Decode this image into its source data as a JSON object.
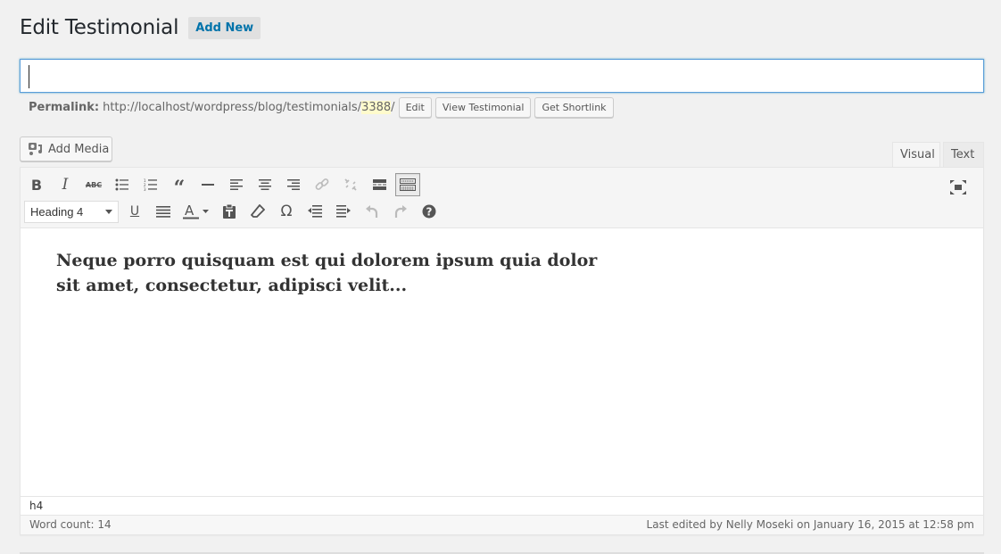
{
  "header": {
    "title": "Edit Testimonial",
    "add_new_label": "Add New"
  },
  "title_input": {
    "value": "",
    "placeholder": ""
  },
  "permalink": {
    "label": "Permalink:",
    "url_prefix": "http://localhost/wordpress/blog/testimonials/",
    "slug": "3388",
    "url_suffix": "/",
    "buttons": [
      "Edit",
      "View Testimonial",
      "Get Shortlink"
    ]
  },
  "media": {
    "add_media_label": "Add Media"
  },
  "editor_tabs": {
    "visual": "Visual",
    "text": "Text",
    "active": "Visual"
  },
  "toolbar": {
    "row1": [
      {
        "name": "bold",
        "icon": "bold-icon"
      },
      {
        "name": "italic",
        "icon": "italic-icon"
      },
      {
        "name": "strikethrough",
        "icon": "strikethrough-icon"
      },
      {
        "name": "bulleted-list",
        "icon": "bulleted-list-icon"
      },
      {
        "name": "numbered-list",
        "icon": "numbered-list-icon"
      },
      {
        "name": "blockquote",
        "icon": "blockquote-icon"
      },
      {
        "name": "horizontal-line",
        "icon": "horizontal-line-icon"
      },
      {
        "name": "align-left",
        "icon": "align-left-icon"
      },
      {
        "name": "align-center",
        "icon": "align-center-icon"
      },
      {
        "name": "align-right",
        "icon": "align-right-icon"
      },
      {
        "name": "insert-link",
        "icon": "link-icon",
        "disabled": true
      },
      {
        "name": "remove-link",
        "icon": "unlink-icon",
        "disabled": true
      },
      {
        "name": "read-more",
        "icon": "read-more-icon"
      },
      {
        "name": "toolbar-toggle",
        "icon": "keyboard-icon",
        "active": true
      }
    ],
    "format_select": {
      "selected": "Heading 4"
    },
    "row2": [
      {
        "name": "underline",
        "icon": "underline-icon"
      },
      {
        "name": "justify",
        "icon": "justify-icon"
      },
      {
        "name": "text-color",
        "icon": "text-color-icon"
      },
      {
        "name": "paste-as-text",
        "icon": "paste-text-icon"
      },
      {
        "name": "clear-formatting",
        "icon": "eraser-icon"
      },
      {
        "name": "special-character",
        "icon": "omega-icon"
      },
      {
        "name": "outdent",
        "icon": "outdent-icon"
      },
      {
        "name": "indent",
        "icon": "indent-icon"
      },
      {
        "name": "undo",
        "icon": "undo-icon",
        "disabled": true
      },
      {
        "name": "redo",
        "icon": "redo-icon",
        "disabled": true
      },
      {
        "name": "help",
        "icon": "help-icon"
      }
    ],
    "fullscreen_icon": "fullscreen-icon"
  },
  "content": {
    "text": "Neque porro quisquam est qui dolorem ipsum quia dolor sit amet, consectetur, adipisci velit..."
  },
  "status": {
    "path": "h4",
    "word_count": "Word count: 14",
    "last_edited": "Last edited by Nelly Moseki on January 16, 2015 at 12:58 pm"
  },
  "colors": {
    "accent": "#0073aa",
    "focus_border": "#5b9dd9",
    "slug_highlight": "#fffbcc"
  }
}
